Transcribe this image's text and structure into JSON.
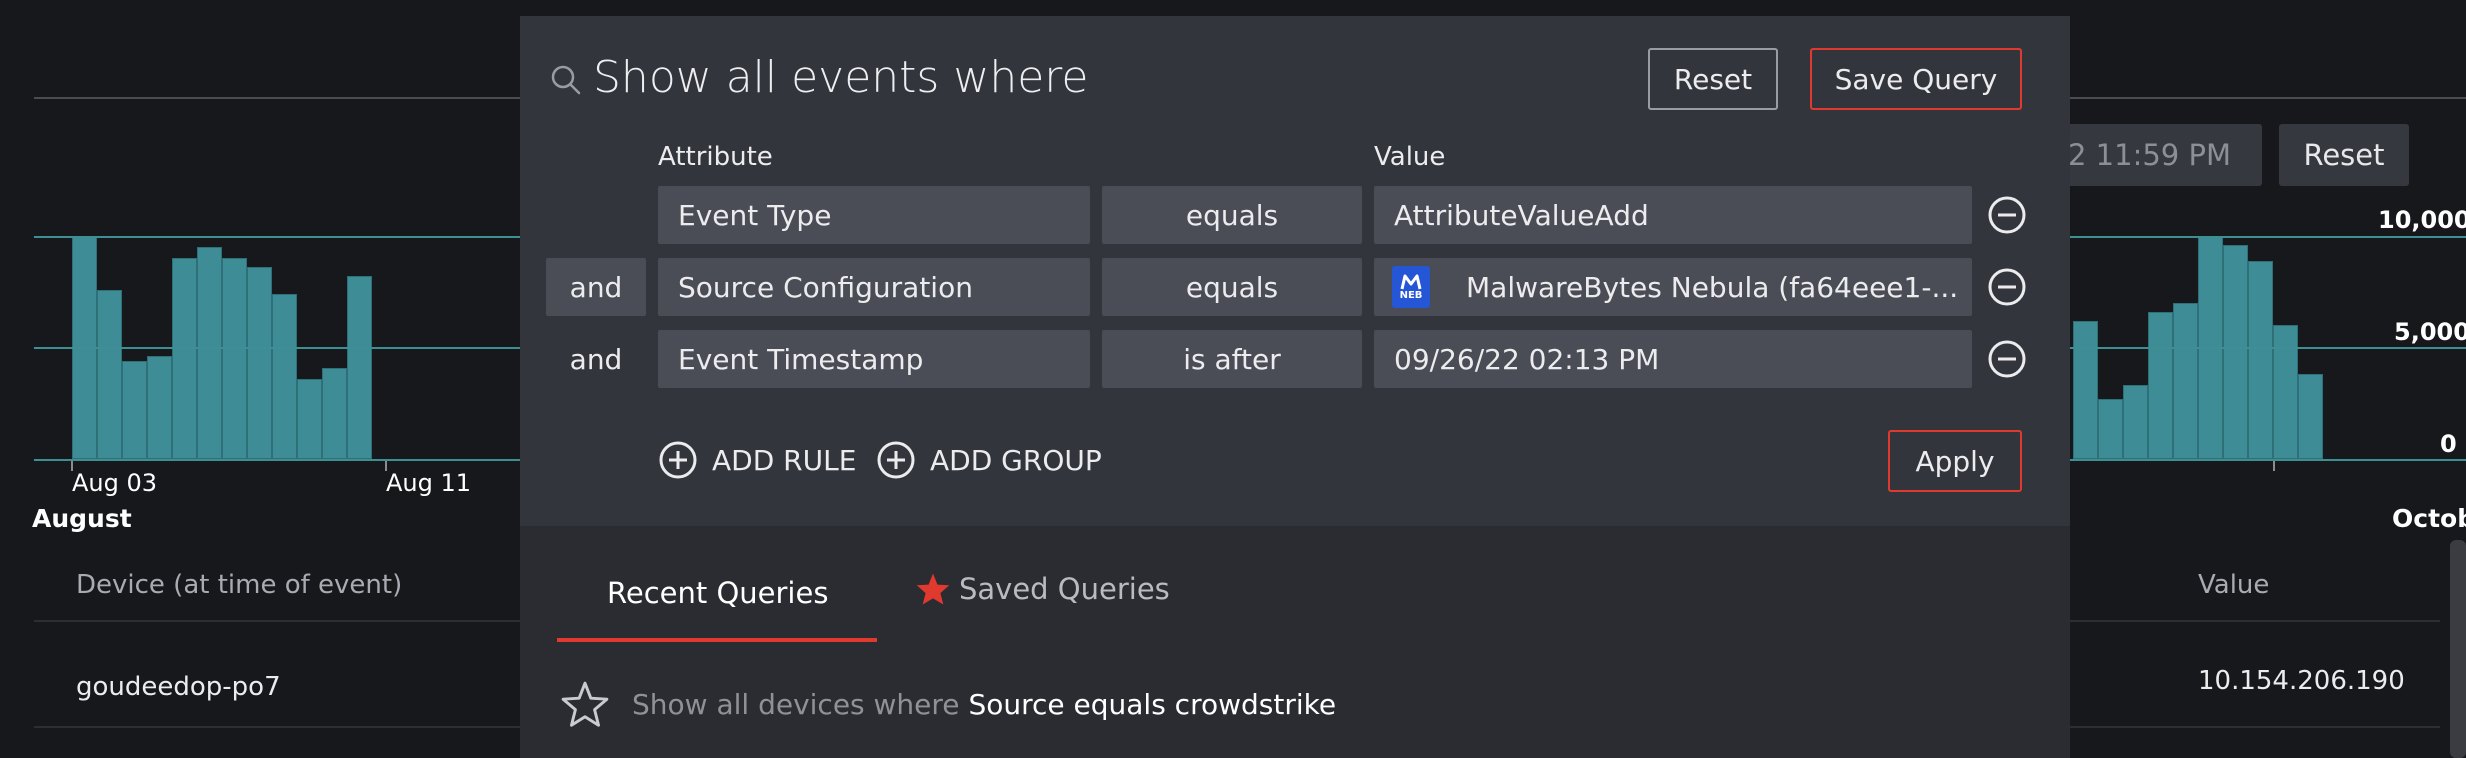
{
  "colors": {
    "accent_red": "#e03a2f",
    "bar_teal": "#3e8c96",
    "grid_teal": "#3d8f93",
    "modal_bg": "#33353d",
    "field_bg": "#4a4d56",
    "page_bg": "#17181c"
  },
  "background": {
    "date_range_partial": "2 11:59 PM",
    "reset_label": "Reset",
    "table": {
      "col_device": "Device (at time of event)",
      "col_value": "Value",
      "rows": [
        {
          "device": "goudeedop-po7",
          "value": "10.154.206.190"
        }
      ]
    }
  },
  "chart_data": [
    {
      "type": "bar",
      "title": "",
      "xlabel": "",
      "ylabel": "",
      "grid": true,
      "x_ticks": [
        "Aug 03",
        "Aug 11"
      ],
      "month_label": "August",
      "values": [
        10000,
        7600,
        4400,
        4600,
        9000,
        9500,
        9000,
        8600,
        7400,
        3600,
        4100,
        8200
      ]
    },
    {
      "type": "bar",
      "title": "",
      "xlabel": "",
      "ylabel": "",
      "grid": true,
      "month_label": "Octob",
      "y_ticks": [
        "10,000",
        "5,000",
        "0"
      ],
      "ylim": [
        0,
        11200
      ],
      "values": [
        6200,
        2700,
        3300,
        6600,
        7000,
        10000,
        9600,
        8900,
        6000,
        3800
      ]
    }
  ],
  "query_builder": {
    "search_icon": "search-icon",
    "title": "Show all events where",
    "reset_label": "Reset",
    "save_label": "Save Query",
    "header_attribute": "Attribute",
    "header_value": "Value",
    "rules": [
      {
        "conjunction": "",
        "attribute": "Event Type",
        "operator": "equals",
        "value": "AttributeValueAdd",
        "logo": ""
      },
      {
        "conjunction": "and",
        "attribute": "Source Configuration",
        "operator": "equals",
        "value": "MalwareBytes Nebula (fa64eee1-...",
        "logo": "NEB"
      },
      {
        "conjunction": "and",
        "attribute": "Event Timestamp",
        "operator": "is after",
        "value": "09/26/22 02:13 PM",
        "logo": ""
      }
    ],
    "add_rule_label": "ADD RULE",
    "add_group_label": "ADD GROUP",
    "apply_label": "Apply"
  },
  "queries_panel": {
    "tabs": [
      {
        "label": "Recent Queries",
        "active": true,
        "icon": ""
      },
      {
        "label": "Saved Queries",
        "active": false,
        "icon": "star-icon"
      }
    ],
    "recent": [
      {
        "prefix": "Show all devices where",
        "text": "Source equals crowdstrike",
        "icon": "star-outline-icon"
      }
    ]
  }
}
